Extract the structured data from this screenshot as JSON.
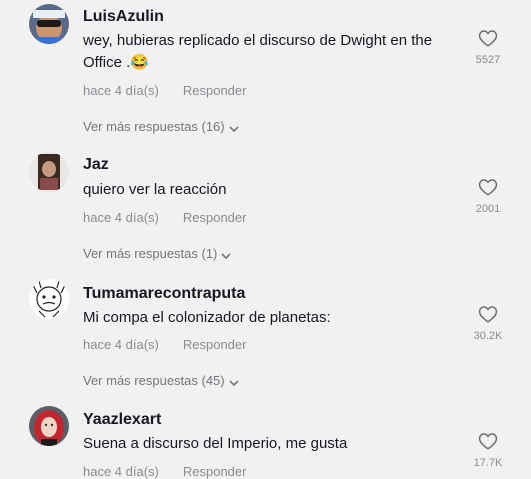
{
  "comments": [
    {
      "username": "LuisAzulin",
      "text": "wey, hubieras replicado el discurso de Dwight en the Office .😂",
      "time": "hace 4 día(s)",
      "reply_label": "Responder",
      "likes": "5527",
      "more_replies": "Ver más respuestas (16)"
    },
    {
      "username": "Jaz",
      "text": "quiero ver la reacción",
      "time": "hace 4 día(s)",
      "reply_label": "Responder",
      "likes": "2001",
      "more_replies": "Ver más respuestas (1)"
    },
    {
      "username": "Tumamarecontraputa",
      "text": "Mi compa el colonizador de planetas:",
      "time": "hace 4 día(s)",
      "reply_label": "Responder",
      "likes": "30.2K",
      "more_replies": "Ver más respuestas (45)"
    },
    {
      "username": "Yaazlexart",
      "text": "Suena a discurso del Imperio, me gusta",
      "time": "hace 4 día(s)",
      "reply_label": "Responder",
      "likes": "17.7K"
    }
  ],
  "icons": {
    "like": "heart-outline-icon",
    "expand": "chevron-down-icon"
  },
  "colors": {
    "background": "#f1f1f2",
    "username": "#161823",
    "secondary": "#8a8b91"
  }
}
